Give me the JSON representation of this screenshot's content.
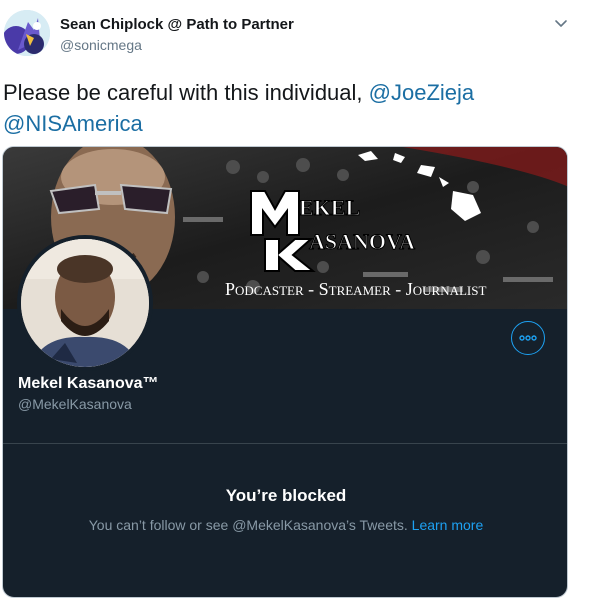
{
  "author": {
    "name": "Sean Chiplock @ Path to Partner",
    "handle": "@sonicmega",
    "avatar_icon": "avatar-icon"
  },
  "tweet": {
    "text": "Please be careful with this individual, ",
    "mention_1": "@JoeZieja",
    "mention_2": "@NISAmerica"
  },
  "card": {
    "banner": {
      "logo_line_1": "EKEL",
      "logo_line_2": "ASANOVA",
      "tagline": "Podcaster - Streamer - Journalist"
    },
    "profile_name": "Mekel Kasanova™",
    "profile_handle": "@MekelKasanova",
    "blocked_title": "You’re blocked",
    "blocked_message": "You can’t follow or see @MekelKasanova’s Tweets. ",
    "learn_more": "Learn more"
  },
  "colors": {
    "link": "#1b6ea3",
    "accent": "#1da1f2",
    "card_bg": "#15202b",
    "muted": "#8899a6"
  }
}
